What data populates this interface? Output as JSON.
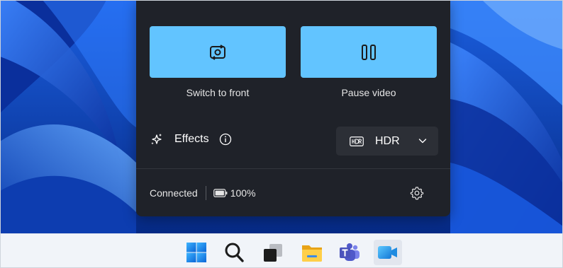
{
  "flyout": {
    "switch_button": {
      "label": "Switch to front",
      "icon": "switch-camera-icon"
    },
    "pause_button": {
      "label": "Pause video",
      "icon": "pause-icon"
    },
    "effects": {
      "label": "Effects",
      "icon": "sparkle-icon",
      "info_icon": "info-icon"
    },
    "hdr_dropdown": {
      "value": "HDR",
      "icon": "hdr-badge-icon"
    },
    "status": {
      "connection": "Connected",
      "battery": "100%",
      "battery_icon": "battery-icon"
    },
    "settings_icon": "gear-icon"
  },
  "taskbar": {
    "items": [
      {
        "name": "start",
        "icon": "windows-logo-icon"
      },
      {
        "name": "search",
        "icon": "search-icon"
      },
      {
        "name": "task-view",
        "icon": "task-view-icon"
      },
      {
        "name": "file-explorer",
        "icon": "folder-icon"
      },
      {
        "name": "teams",
        "icon": "teams-icon"
      },
      {
        "name": "camera-app",
        "icon": "video-camera-icon",
        "active": true
      }
    ]
  },
  "colors": {
    "flyout_bg": "#1f2229",
    "accent_button": "#62c4ff",
    "dropdown_bg": "#2c2f36",
    "taskbar_bg": "#f1f4f9",
    "wallpaper": "#0b48c2"
  }
}
